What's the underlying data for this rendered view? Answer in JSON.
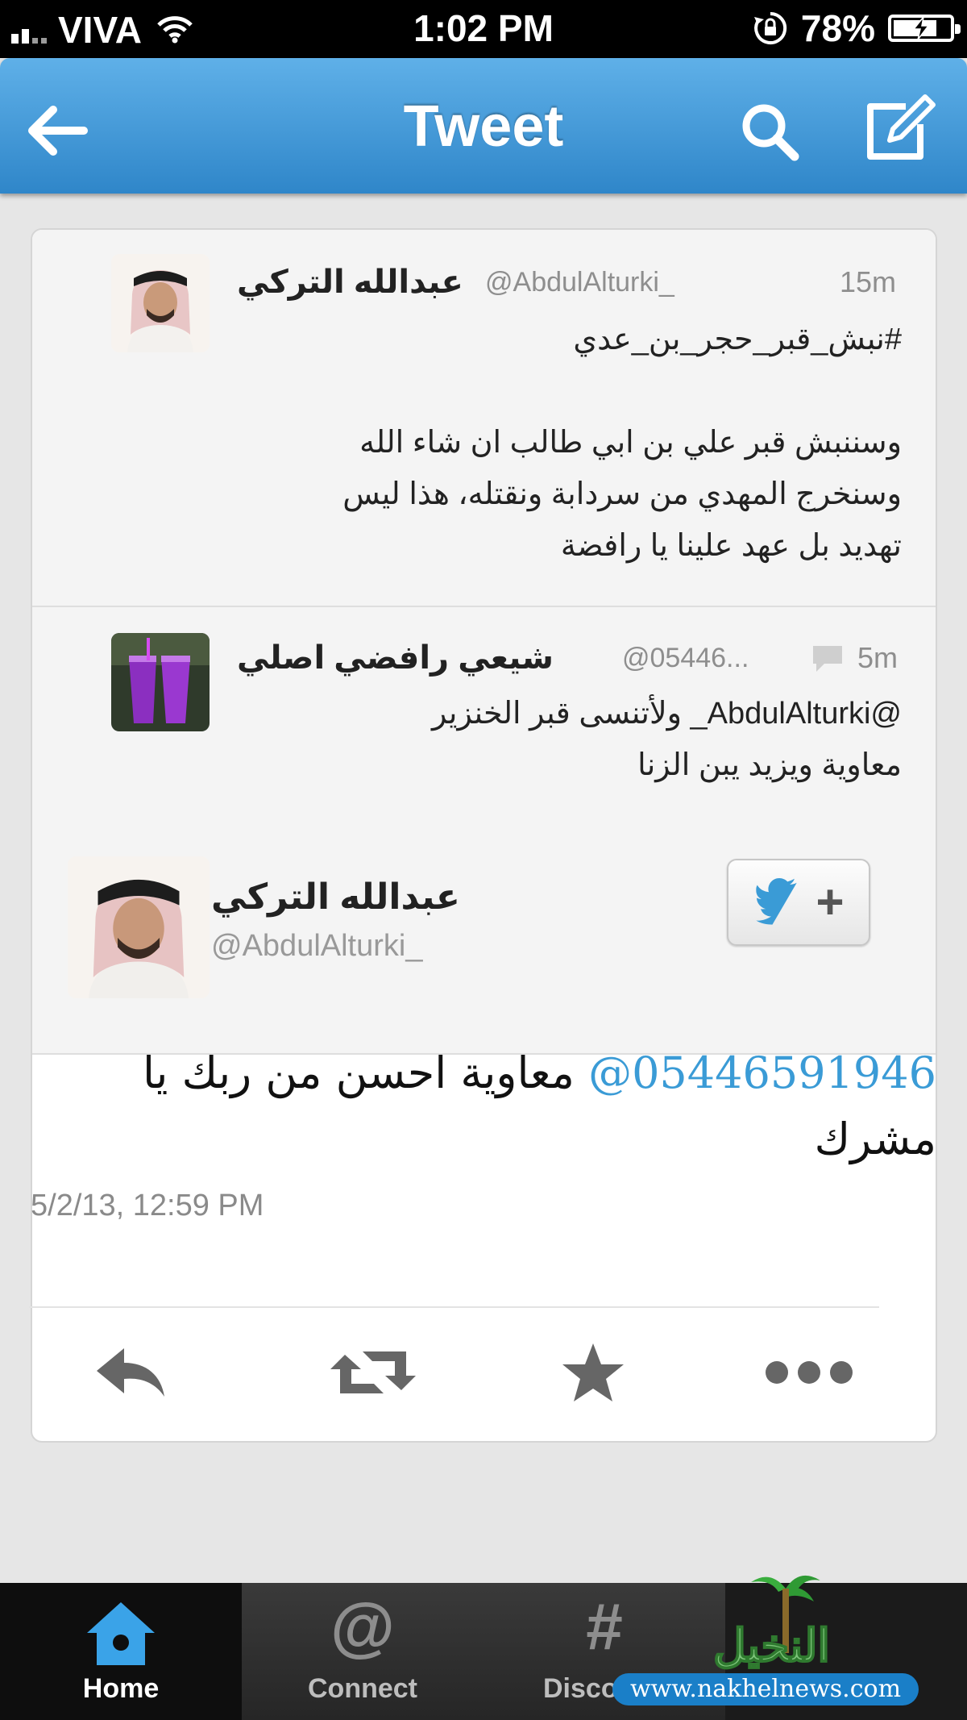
{
  "status_bar": {
    "carrier": "VIVA",
    "time": "1:02 PM",
    "battery": "78%",
    "battery_level": 0.78,
    "icons": [
      "signal-icon",
      "wifi-icon",
      "rotation-lock-icon",
      "battery-charging-icon"
    ]
  },
  "nav": {
    "title": "Tweet",
    "icons": [
      "back-arrow-icon",
      "search-icon",
      "compose-icon"
    ]
  },
  "tweets": [
    {
      "name": "عبدالله التركي",
      "handle": "@AbdulAlturki_",
      "time": "15m",
      "lines": [
        "#نبش_قبر_حجر_بن_عدي",
        "",
        "وسننبش قبر علي بن ابي طالب ان شاء الله",
        "وسنخرج المهدي من سردابة ونقتله، هذا ليس",
        "تهديد بل عهد علينا يا رافضة"
      ]
    },
    {
      "name": "شيعي رافضي اصلي",
      "handle": "@05446...",
      "time": "5m",
      "lines": [
        "@AbdulAlturki_ ولأتنسى قبر الخنزير",
        "معاوية ويزيد يبن الزنا"
      ]
    }
  ],
  "main_tweet": {
    "name": "عبدالله التركي",
    "handle": "@AbdulAlturki_",
    "mention": "@05446591946",
    "text": "معاوية احسن من ربك يا",
    "text_line2": "مشرك",
    "date": "5/2/13, 12:59 PM",
    "actions": [
      "reply-icon",
      "retweet-icon",
      "favorite-star-icon",
      "more-dots-icon"
    ]
  },
  "tabs": [
    {
      "label": "Home",
      "icon": "home-icon"
    },
    {
      "label": "Connect",
      "icon": "at-sign-icon",
      "glyph": "@"
    },
    {
      "label": "Disco",
      "icon": "hashtag-icon",
      "glyph": "#"
    }
  ],
  "watermark": {
    "url": "www.nakhelnews.com",
    "logo_text": "النخيل"
  }
}
